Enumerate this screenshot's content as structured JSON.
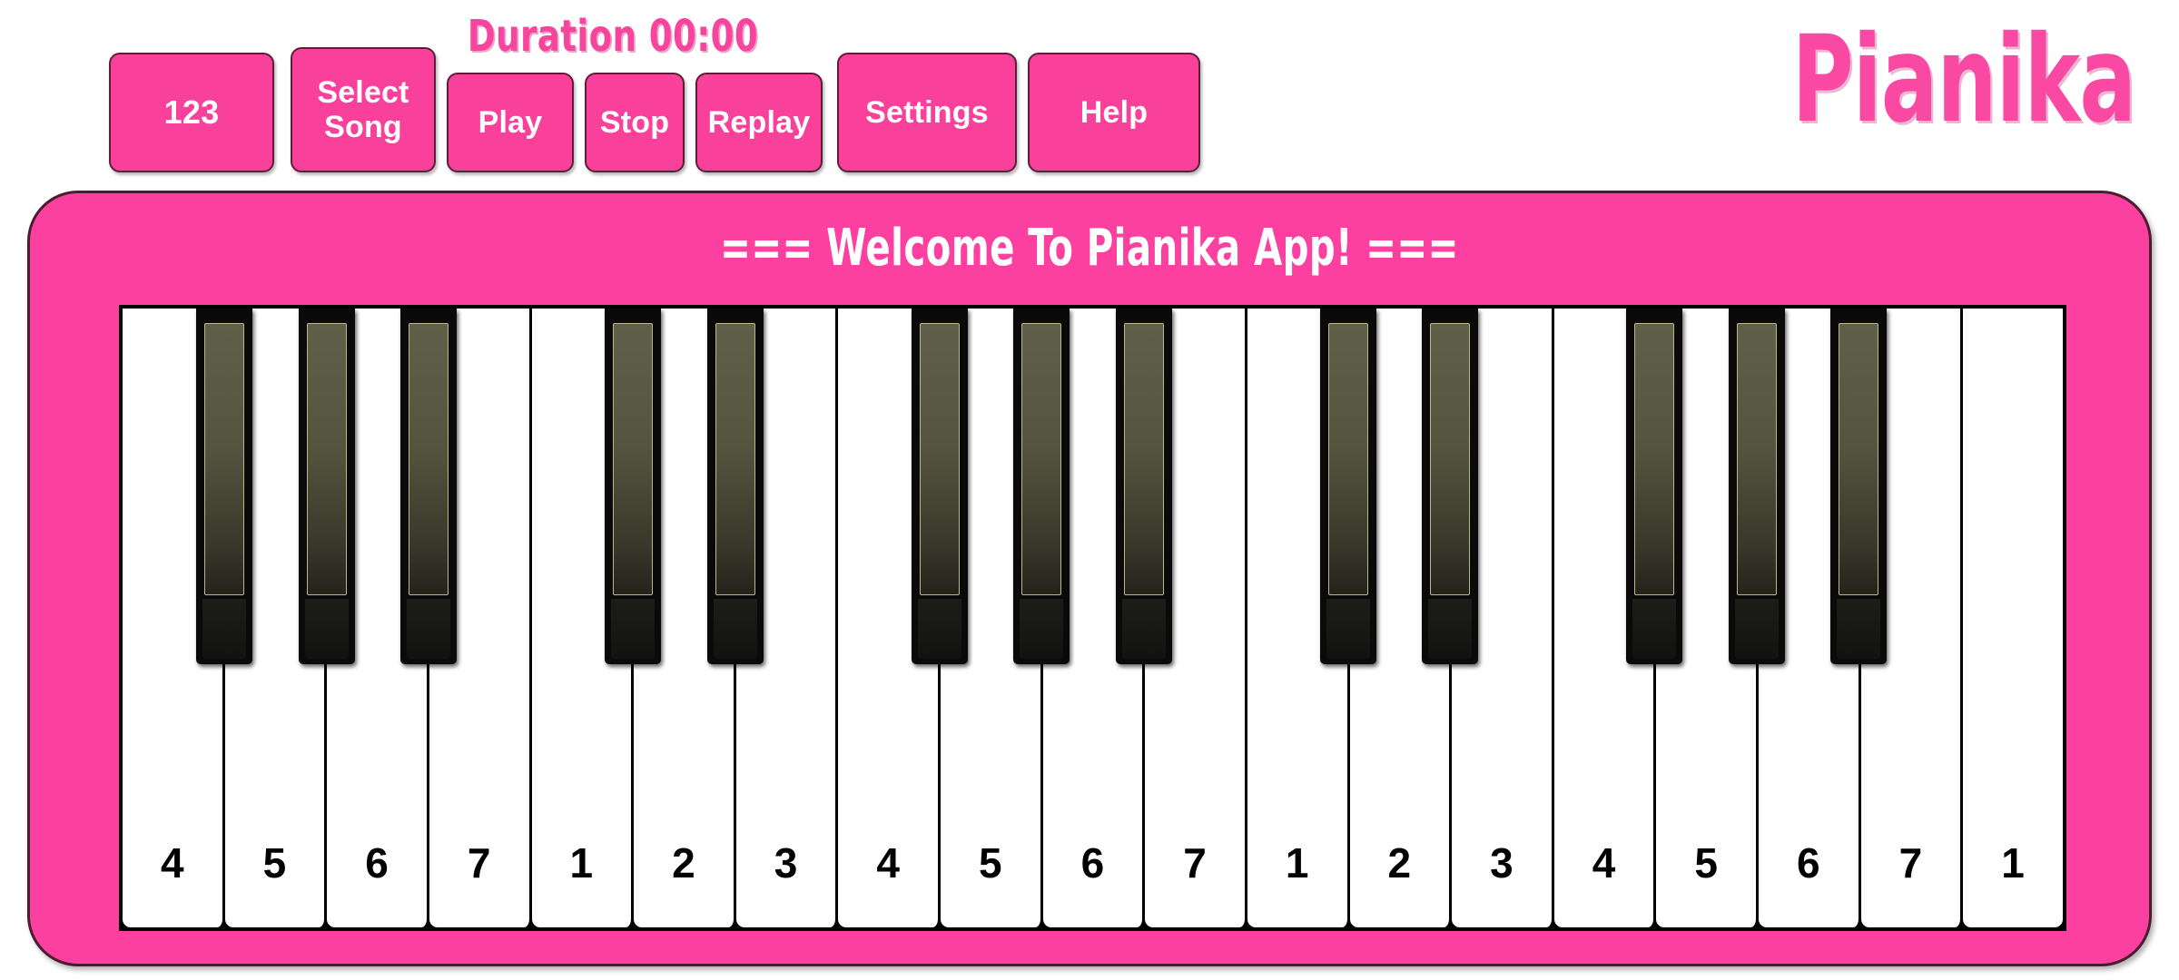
{
  "app": {
    "logo": "Pianika",
    "welcome_banner": "=== Welcome To Pianika App! ===",
    "colors": {
      "frame_pink": "#FC40A0",
      "button_pink": "#F9409A",
      "logo_pink": "#FA49A3",
      "duration_pink": "#F7459E",
      "key_white": "#FFFFFF",
      "key_black": "#0A0A0A",
      "black_key_face": "#54543F",
      "border_dark": "#4B1C30"
    }
  },
  "toolbar": {
    "duration_label": "Duration 00:00",
    "buttons": [
      {
        "id": "123",
        "label": "123"
      },
      {
        "id": "select",
        "label": "Select Song"
      },
      {
        "id": "play",
        "label": "Play"
      },
      {
        "id": "stop",
        "label": "Stop"
      },
      {
        "id": "replay",
        "label": "Replay"
      },
      {
        "id": "settings",
        "label": "Settings"
      },
      {
        "id": "help",
        "label": "Help"
      }
    ]
  },
  "keyboard": {
    "white_key_count": 19,
    "black_key_count": 13,
    "white_keys": [
      {
        "label": "4"
      },
      {
        "label": "5"
      },
      {
        "label": "6"
      },
      {
        "label": "7"
      },
      {
        "label": "1"
      },
      {
        "label": "2"
      },
      {
        "label": "3"
      },
      {
        "label": "4"
      },
      {
        "label": "5"
      },
      {
        "label": "6"
      },
      {
        "label": "7"
      },
      {
        "label": "1"
      },
      {
        "label": "2"
      },
      {
        "label": "3"
      },
      {
        "label": "4"
      },
      {
        "label": "5"
      },
      {
        "label": "6"
      },
      {
        "label": "7"
      },
      {
        "label": "1"
      }
    ],
    "black_key_after_white_index": [
      0,
      1,
      2,
      4,
      5,
      7,
      8,
      9,
      11,
      12,
      14,
      15,
      16
    ]
  }
}
